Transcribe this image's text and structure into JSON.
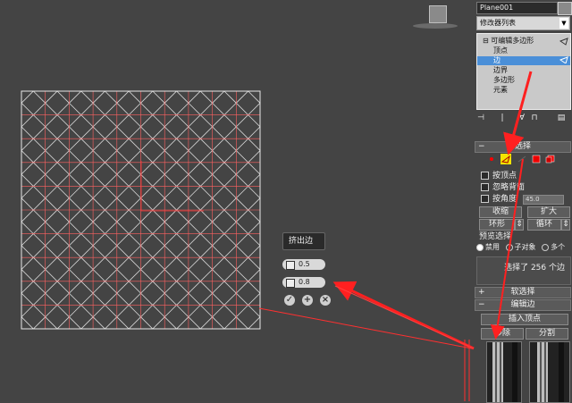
{
  "caddy": {
    "title": "挤出边",
    "height_value": "0.5",
    "width_value": "0.8"
  },
  "command_panel": {
    "object_name": "Plane001",
    "modifier_list": "修改器列表",
    "stack": {
      "root": "可编辑多边形",
      "children": [
        "顶点",
        "边",
        "边界",
        "多边形",
        "元素"
      ],
      "selected": "边"
    },
    "selection_rollout": {
      "title": "选择",
      "by_vertex": "按顶点",
      "ignore_backfacing": "忽略背面",
      "by_angle": "按角度",
      "angle_value": "45.0",
      "shrink": "收缩",
      "grow": "扩大",
      "ring": "环形",
      "loop": "循环",
      "preview_label": "预览选择",
      "preview_options": [
        "禁用",
        "子对象",
        "多个"
      ],
      "status": "选择了 256 个边"
    },
    "soft_selection_title": "软选择",
    "edit_edges_title": "编辑边",
    "insert_vertex": "插入顶点",
    "remove": "移除",
    "split": "分割"
  },
  "colors": {
    "accent_red": "#ff2020",
    "selection_yellow": "#f4e400",
    "stack_highlight": "#4a8fd8"
  }
}
